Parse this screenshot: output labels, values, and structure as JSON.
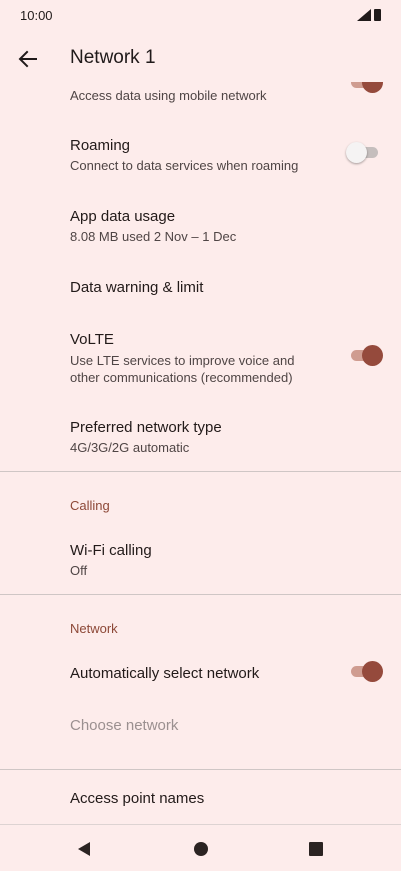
{
  "status_bar": {
    "time": "10:00"
  },
  "header": {
    "title": "Network 1"
  },
  "items": {
    "mobile_data": {
      "summary": "Access data using mobile network",
      "on": true
    },
    "roaming": {
      "title": "Roaming",
      "summary": "Connect to data services when roaming",
      "on": false
    },
    "app_data_usage": {
      "title": "App data usage",
      "summary": "8.08 MB used 2 Nov – 1 Dec"
    },
    "data_warning": {
      "title": "Data warning & limit"
    },
    "volte": {
      "title": "VoLTE",
      "summary_line1": "Use LTE services to improve voice and",
      "summary_line2": "other communications (recommended)",
      "on": true
    },
    "preferred_network": {
      "title": "Preferred network type",
      "summary": "4G/3G/2G automatic"
    },
    "wifi_calling": {
      "title": "Wi-Fi calling",
      "summary": "Off"
    },
    "auto_select": {
      "title": "Automatically select network",
      "on": true
    },
    "choose_network": {
      "title": "Choose network"
    },
    "apn": {
      "title": "Access point names"
    }
  },
  "sections": {
    "calling": "Calling",
    "network": "Network"
  },
  "colors": {
    "background": "#fdeceb",
    "accent": "#954a3c",
    "section_header": "#8d4837"
  }
}
